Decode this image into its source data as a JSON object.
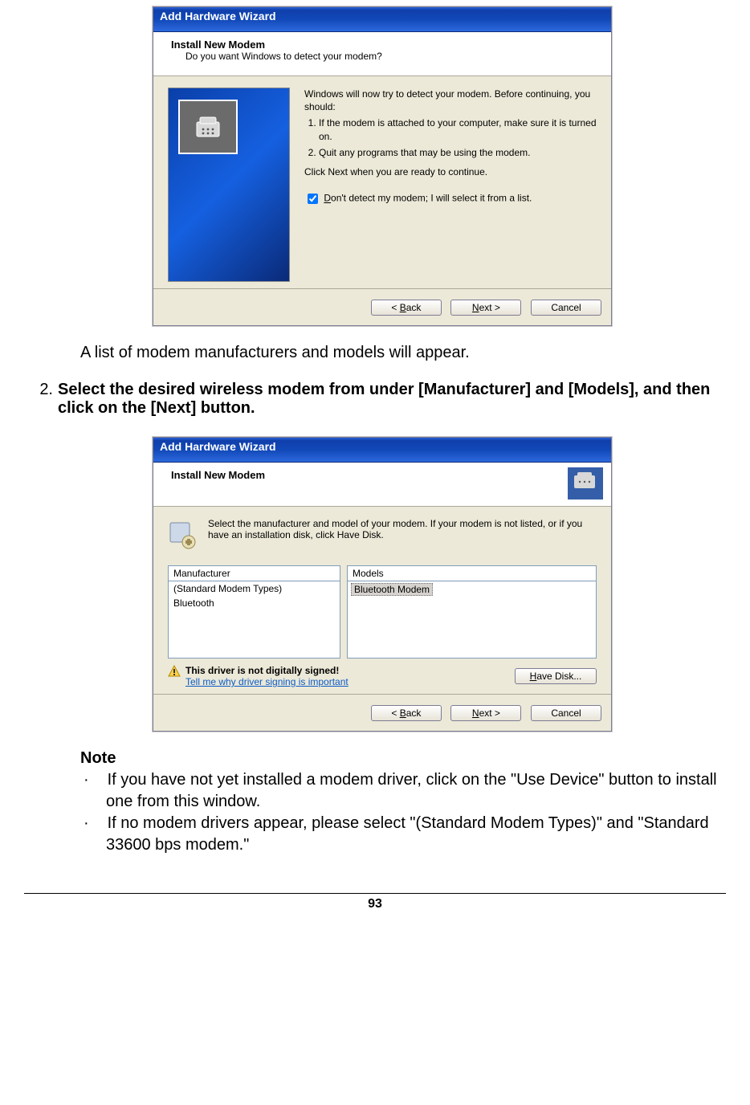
{
  "dialog1": {
    "title": "Add Hardware Wizard",
    "header_title": "Install New Modem",
    "header_sub": "Do you want Windows to detect your modem?",
    "intro": "Windows will now try to detect your modem.  Before continuing, you should:",
    "step1": "If the modem is attached to your computer, make sure it is turned on.",
    "step2": "Quit any programs that may be using the modem.",
    "cont": "Click Next when you are ready to continue.",
    "checkbox_label_pre": "D",
    "checkbox_label_rest": "on't detect my modem; I will select it from a list.",
    "back": "< Back",
    "next": "Next >",
    "cancel": "Cancel"
  },
  "doc": {
    "after_d1": "A list of modem manufacturers and models will appear.",
    "step_num": "2.",
    "step_text": "Select the desired wireless modem from under [Manufacturer] and [Models], and then click on the [Next] button."
  },
  "dialog2": {
    "title": "Add Hardware Wizard",
    "header_title": "Install New Modem",
    "instr": "Select the manufacturer and model of your modem. If your modem is not listed, or if you have an installation disk, click Have Disk.",
    "col1_head": "Manufacturer",
    "col2_head": "Models",
    "mfr1": "(Standard Modem Types)",
    "mfr2": "Bluetooth",
    "model_sel": "Bluetooth Modem",
    "sign_warn": "This driver is not digitally signed!",
    "sign_link": "Tell me why driver signing is important",
    "have_disk": "Have Disk...",
    "back": "< Back",
    "next": "Next >",
    "cancel": "Cancel"
  },
  "note": {
    "title": "Note",
    "n1": "If you have not yet installed a modem driver, click on the \"Use Device\" button to install one from this window.",
    "n2": "If no modem drivers appear, please select \"(Standard Modem Types)\" and \"Standard 33600 bps modem.\""
  },
  "page_number": "93"
}
